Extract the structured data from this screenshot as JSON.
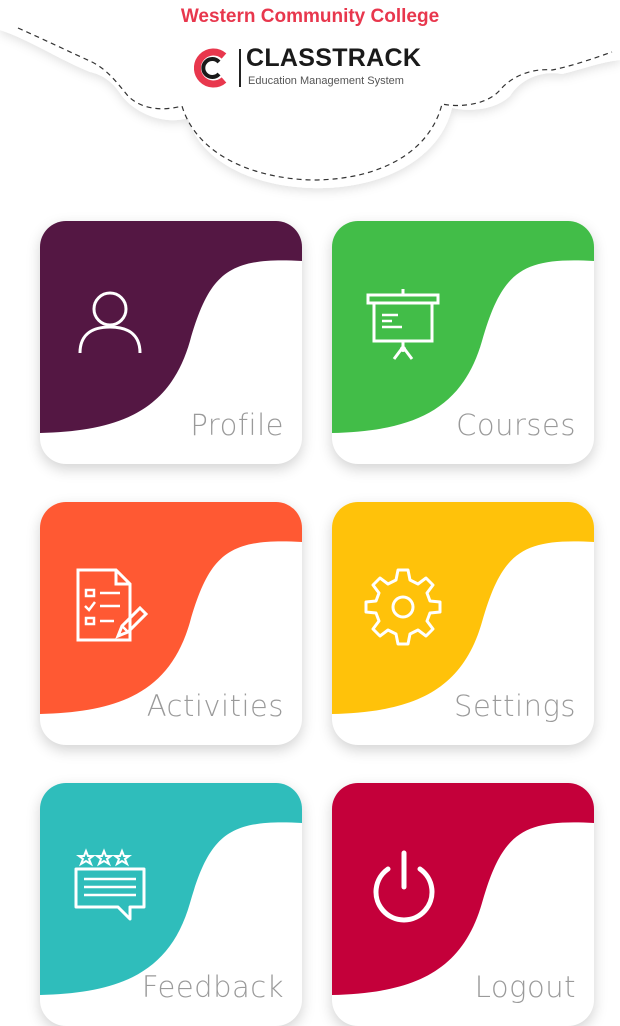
{
  "header": {
    "college_name": "Western Community College",
    "app_name": "CLASSTRACK",
    "tagline": "Education Management System",
    "brand_color": "#e8374d"
  },
  "menu": {
    "tiles": [
      {
        "label": "Profile",
        "icon": "user-icon",
        "color": "#541743"
      },
      {
        "label": "Courses",
        "icon": "presentation-board-icon",
        "color": "#42bd48"
      },
      {
        "label": "Activities",
        "icon": "checklist-document-icon",
        "color": "#ff5933"
      },
      {
        "label": "Settings",
        "icon": "gear-icon",
        "color": "#ffc20a"
      },
      {
        "label": "Feedback",
        "icon": "rating-feedback-icon",
        "color": "#2fbdbb"
      },
      {
        "label": "Logout",
        "icon": "power-icon",
        "color": "#c4003a"
      }
    ]
  }
}
